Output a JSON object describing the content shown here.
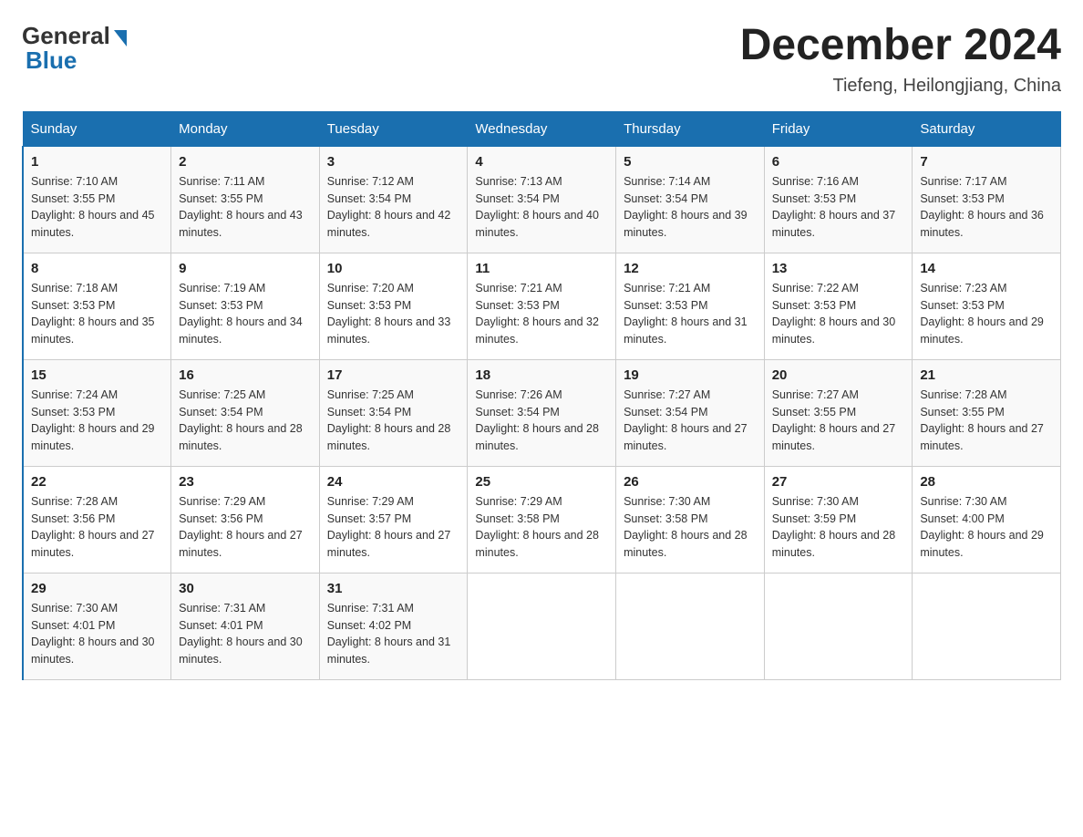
{
  "logo": {
    "general": "General",
    "blue": "Blue",
    "subtitle": "Blue"
  },
  "header": {
    "month": "December 2024",
    "location": "Tiefeng, Heilongjiang, China"
  },
  "days_of_week": [
    "Sunday",
    "Monday",
    "Tuesday",
    "Wednesday",
    "Thursday",
    "Friday",
    "Saturday"
  ],
  "weeks": [
    [
      {
        "day": "1",
        "sunrise": "7:10 AM",
        "sunset": "3:55 PM",
        "daylight": "8 hours and 45 minutes."
      },
      {
        "day": "2",
        "sunrise": "7:11 AM",
        "sunset": "3:55 PM",
        "daylight": "8 hours and 43 minutes."
      },
      {
        "day": "3",
        "sunrise": "7:12 AM",
        "sunset": "3:54 PM",
        "daylight": "8 hours and 42 minutes."
      },
      {
        "day": "4",
        "sunrise": "7:13 AM",
        "sunset": "3:54 PM",
        "daylight": "8 hours and 40 minutes."
      },
      {
        "day": "5",
        "sunrise": "7:14 AM",
        "sunset": "3:54 PM",
        "daylight": "8 hours and 39 minutes."
      },
      {
        "day": "6",
        "sunrise": "7:16 AM",
        "sunset": "3:53 PM",
        "daylight": "8 hours and 37 minutes."
      },
      {
        "day": "7",
        "sunrise": "7:17 AM",
        "sunset": "3:53 PM",
        "daylight": "8 hours and 36 minutes."
      }
    ],
    [
      {
        "day": "8",
        "sunrise": "7:18 AM",
        "sunset": "3:53 PM",
        "daylight": "8 hours and 35 minutes."
      },
      {
        "day": "9",
        "sunrise": "7:19 AM",
        "sunset": "3:53 PM",
        "daylight": "8 hours and 34 minutes."
      },
      {
        "day": "10",
        "sunrise": "7:20 AM",
        "sunset": "3:53 PM",
        "daylight": "8 hours and 33 minutes."
      },
      {
        "day": "11",
        "sunrise": "7:21 AM",
        "sunset": "3:53 PM",
        "daylight": "8 hours and 32 minutes."
      },
      {
        "day": "12",
        "sunrise": "7:21 AM",
        "sunset": "3:53 PM",
        "daylight": "8 hours and 31 minutes."
      },
      {
        "day": "13",
        "sunrise": "7:22 AM",
        "sunset": "3:53 PM",
        "daylight": "8 hours and 30 minutes."
      },
      {
        "day": "14",
        "sunrise": "7:23 AM",
        "sunset": "3:53 PM",
        "daylight": "8 hours and 29 minutes."
      }
    ],
    [
      {
        "day": "15",
        "sunrise": "7:24 AM",
        "sunset": "3:53 PM",
        "daylight": "8 hours and 29 minutes."
      },
      {
        "day": "16",
        "sunrise": "7:25 AM",
        "sunset": "3:54 PM",
        "daylight": "8 hours and 28 minutes."
      },
      {
        "day": "17",
        "sunrise": "7:25 AM",
        "sunset": "3:54 PM",
        "daylight": "8 hours and 28 minutes."
      },
      {
        "day": "18",
        "sunrise": "7:26 AM",
        "sunset": "3:54 PM",
        "daylight": "8 hours and 28 minutes."
      },
      {
        "day": "19",
        "sunrise": "7:27 AM",
        "sunset": "3:54 PM",
        "daylight": "8 hours and 27 minutes."
      },
      {
        "day": "20",
        "sunrise": "7:27 AM",
        "sunset": "3:55 PM",
        "daylight": "8 hours and 27 minutes."
      },
      {
        "day": "21",
        "sunrise": "7:28 AM",
        "sunset": "3:55 PM",
        "daylight": "8 hours and 27 minutes."
      }
    ],
    [
      {
        "day": "22",
        "sunrise": "7:28 AM",
        "sunset": "3:56 PM",
        "daylight": "8 hours and 27 minutes."
      },
      {
        "day": "23",
        "sunrise": "7:29 AM",
        "sunset": "3:56 PM",
        "daylight": "8 hours and 27 minutes."
      },
      {
        "day": "24",
        "sunrise": "7:29 AM",
        "sunset": "3:57 PM",
        "daylight": "8 hours and 27 minutes."
      },
      {
        "day": "25",
        "sunrise": "7:29 AM",
        "sunset": "3:58 PM",
        "daylight": "8 hours and 28 minutes."
      },
      {
        "day": "26",
        "sunrise": "7:30 AM",
        "sunset": "3:58 PM",
        "daylight": "8 hours and 28 minutes."
      },
      {
        "day": "27",
        "sunrise": "7:30 AM",
        "sunset": "3:59 PM",
        "daylight": "8 hours and 28 minutes."
      },
      {
        "day": "28",
        "sunrise": "7:30 AM",
        "sunset": "4:00 PM",
        "daylight": "8 hours and 29 minutes."
      }
    ],
    [
      {
        "day": "29",
        "sunrise": "7:30 AM",
        "sunset": "4:01 PM",
        "daylight": "8 hours and 30 minutes."
      },
      {
        "day": "30",
        "sunrise": "7:31 AM",
        "sunset": "4:01 PM",
        "daylight": "8 hours and 30 minutes."
      },
      {
        "day": "31",
        "sunrise": "7:31 AM",
        "sunset": "4:02 PM",
        "daylight": "8 hours and 31 minutes."
      },
      null,
      null,
      null,
      null
    ]
  ]
}
